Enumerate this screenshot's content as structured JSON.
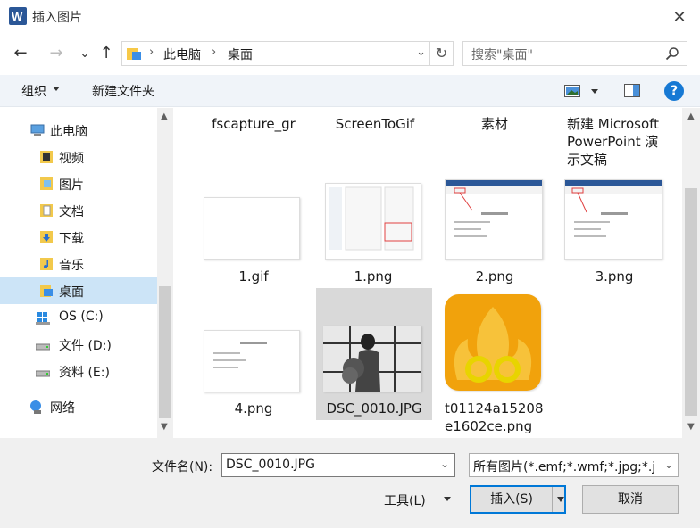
{
  "window": {
    "title": "插入图片",
    "close_glyph": "✕"
  },
  "nav": {
    "back": "←",
    "forward": "→",
    "recent": "⌄",
    "up": "↑",
    "address": {
      "sep": "›",
      "pc": "此电脑",
      "desktop": "桌面",
      "dropdown": "⌄",
      "refresh": "↻"
    },
    "search": {
      "placeholder": "搜索\"桌面\""
    }
  },
  "toolbar": {
    "organize": "组织",
    "new_folder": "新建文件夹",
    "help": "?"
  },
  "sidebar": {
    "items": [
      {
        "label": "此电脑",
        "icon": "computer-icon"
      },
      {
        "label": "视频",
        "icon": "video-folder-icon"
      },
      {
        "label": "图片",
        "icon": "pictures-folder-icon"
      },
      {
        "label": "文档",
        "icon": "documents-folder-icon"
      },
      {
        "label": "下载",
        "icon": "downloads-folder-icon"
      },
      {
        "label": "音乐",
        "icon": "music-folder-icon"
      },
      {
        "label": "桌面",
        "icon": "desktop-folder-icon",
        "selected": true
      },
      {
        "label": "OS (C:)",
        "icon": "windows-drive-icon"
      },
      {
        "label": "文件 (D:)",
        "icon": "drive-icon"
      },
      {
        "label": "资料 (E:)",
        "icon": "drive-icon"
      },
      {
        "label": "网络",
        "icon": "network-icon"
      }
    ],
    "scroll_up": "▲",
    "scroll_down": "▼"
  },
  "files": [
    {
      "label": "fscapture_gr"
    },
    {
      "label": "ScreenToGif"
    },
    {
      "label": "素材"
    },
    {
      "label": "新建 Microsoft PowerPoint 演示文稿"
    },
    {
      "label": "1.gif"
    },
    {
      "label": "1.png"
    },
    {
      "label": "2.png"
    },
    {
      "label": "3.png"
    },
    {
      "label": "4.png"
    },
    {
      "label": "DSC_0010.JPG",
      "selected": true
    },
    {
      "label": "t01124a15208e1602ce.png"
    }
  ],
  "bottom": {
    "filename_label": "文件名(N):",
    "filename_value": "DSC_0010.JPG",
    "filetype_value": "所有图片(*.emf;*.wmf;*.jpg;*.j",
    "tools": "工具(L)",
    "insert": "插入(S)",
    "cancel": "取消",
    "dropdown_glyph": "⌄"
  },
  "colors": {
    "accent": "#0078d7",
    "selection": "#cce4f7",
    "file_selection": "#d9d9d9",
    "help_blue": "#1779d4"
  }
}
